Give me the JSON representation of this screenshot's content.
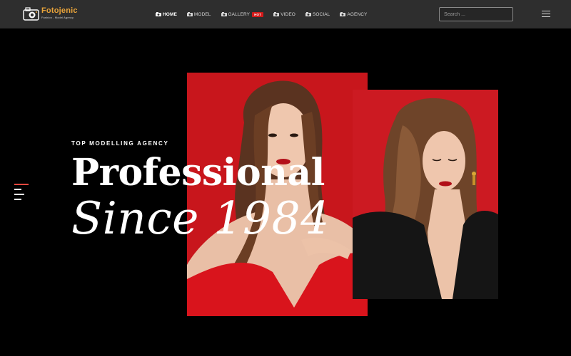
{
  "brand": {
    "name": "Fotojenic",
    "tagline": "Fashion - Model Agency",
    "accent_color": "#e8a33a"
  },
  "nav": {
    "items": [
      {
        "label": "HOME",
        "icon": "camera-icon",
        "active": true
      },
      {
        "label": "MODEL",
        "icon": "camera-icon"
      },
      {
        "label": "GALLERY",
        "icon": "camera-icon",
        "badge": "HOT"
      },
      {
        "label": "VIDEO",
        "icon": "camera-icon"
      },
      {
        "label": "SOCIAL",
        "icon": "camera-icon"
      },
      {
        "label": "AGENCY",
        "icon": "camera-icon"
      }
    ]
  },
  "search": {
    "placeholder": "Search ..."
  },
  "menu_icon": "hamburger-icon",
  "hero": {
    "eyebrow": "TOP MODELLING AGENCY",
    "headline": "Professional",
    "subline": "Since 1984",
    "side_menu_icon": "side-menu-icon",
    "colors": {
      "background": "#000000",
      "header": "#2e2e2e",
      "photo_red": "#c8161c",
      "badge_red": "#d21a1a",
      "side_menu_accent": "#e5483f"
    }
  }
}
